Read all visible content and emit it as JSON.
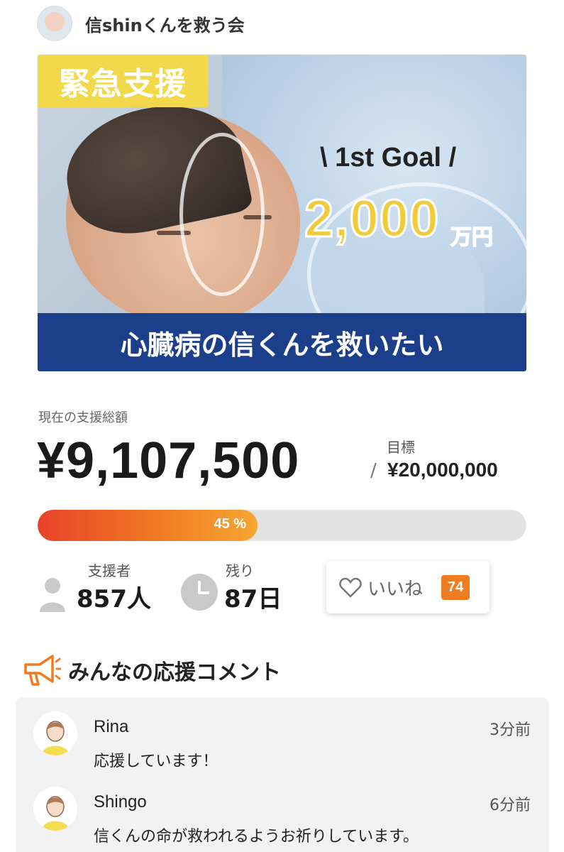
{
  "header": {
    "org_name": "信shinくんを救う会"
  },
  "hero": {
    "badge": "緊急支援",
    "goal_title": "\\ 1st Goal /",
    "goal_amount": "2,000",
    "goal_unit": "万円",
    "banner": "心臓病の信くんを救いたい"
  },
  "totals": {
    "label": "現在の支援総額",
    "amount": "¥9,107,500",
    "target_label": "目標",
    "target_slash": "/",
    "target_amount": "¥20,000,000"
  },
  "progress": {
    "percent": 45,
    "label": "45 %"
  },
  "stats": {
    "supporters_label": "支援者",
    "supporters_value": "857人",
    "remaining_label": "残り",
    "remaining_value": "87日",
    "like_label": "いいね",
    "like_count": "74"
  },
  "comments": {
    "title": "みんなの応援コメント",
    "items": [
      {
        "name": "Rina",
        "time": "3分前",
        "text": "応援しています！"
      },
      {
        "name": "Shingo",
        "time": "6分前",
        "text": "信くんの命が救われるようお祈りしています。"
      }
    ]
  },
  "colors": {
    "accent": "#f07c22",
    "banner": "#1c3f8c",
    "badge": "#f2d94c",
    "progress_track": "#e2e2e2"
  },
  "icons": [
    "org-avatar",
    "person-icon",
    "clock-icon",
    "heart-icon",
    "megaphone-icon",
    "comment-avatar"
  ]
}
